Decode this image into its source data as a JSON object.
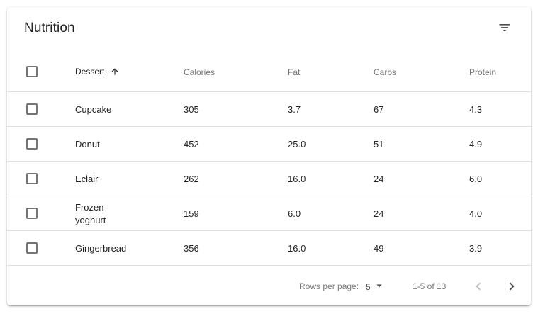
{
  "title": "Nutrition",
  "columns": {
    "dessert": "Dessert",
    "calories": "Calories",
    "fat": "Fat",
    "carbs": "Carbs",
    "protein": "Protein"
  },
  "rows": [
    {
      "dessert": "Cupcake",
      "calories": "305",
      "fat": "3.7",
      "carbs": "67",
      "protein": "4.3"
    },
    {
      "dessert": "Donut",
      "calories": "452",
      "fat": "25.0",
      "carbs": "51",
      "protein": "4.9"
    },
    {
      "dessert": "Eclair",
      "calories": "262",
      "fat": "16.0",
      "carbs": "24",
      "protein": "6.0"
    },
    {
      "dessert": "Frozen yoghurt",
      "calories": "159",
      "fat": "6.0",
      "carbs": "24",
      "protein": "4.0"
    },
    {
      "dessert": "Gingerbread",
      "calories": "356",
      "fat": "16.0",
      "carbs": "49",
      "protein": "3.9"
    }
  ],
  "pagination": {
    "rows_per_page_label": "Rows per page:",
    "rows_per_page_value": "5",
    "range": "1-5 of 13"
  },
  "sort": {
    "column": "dessert",
    "direction": "ascending"
  },
  "icons": {
    "filter": "filter-list-icon",
    "sort": "arrow-upward-icon",
    "prev": "chevron-left-icon",
    "next": "chevron-right-icon",
    "dropdown": "arrow-drop-down-icon"
  }
}
